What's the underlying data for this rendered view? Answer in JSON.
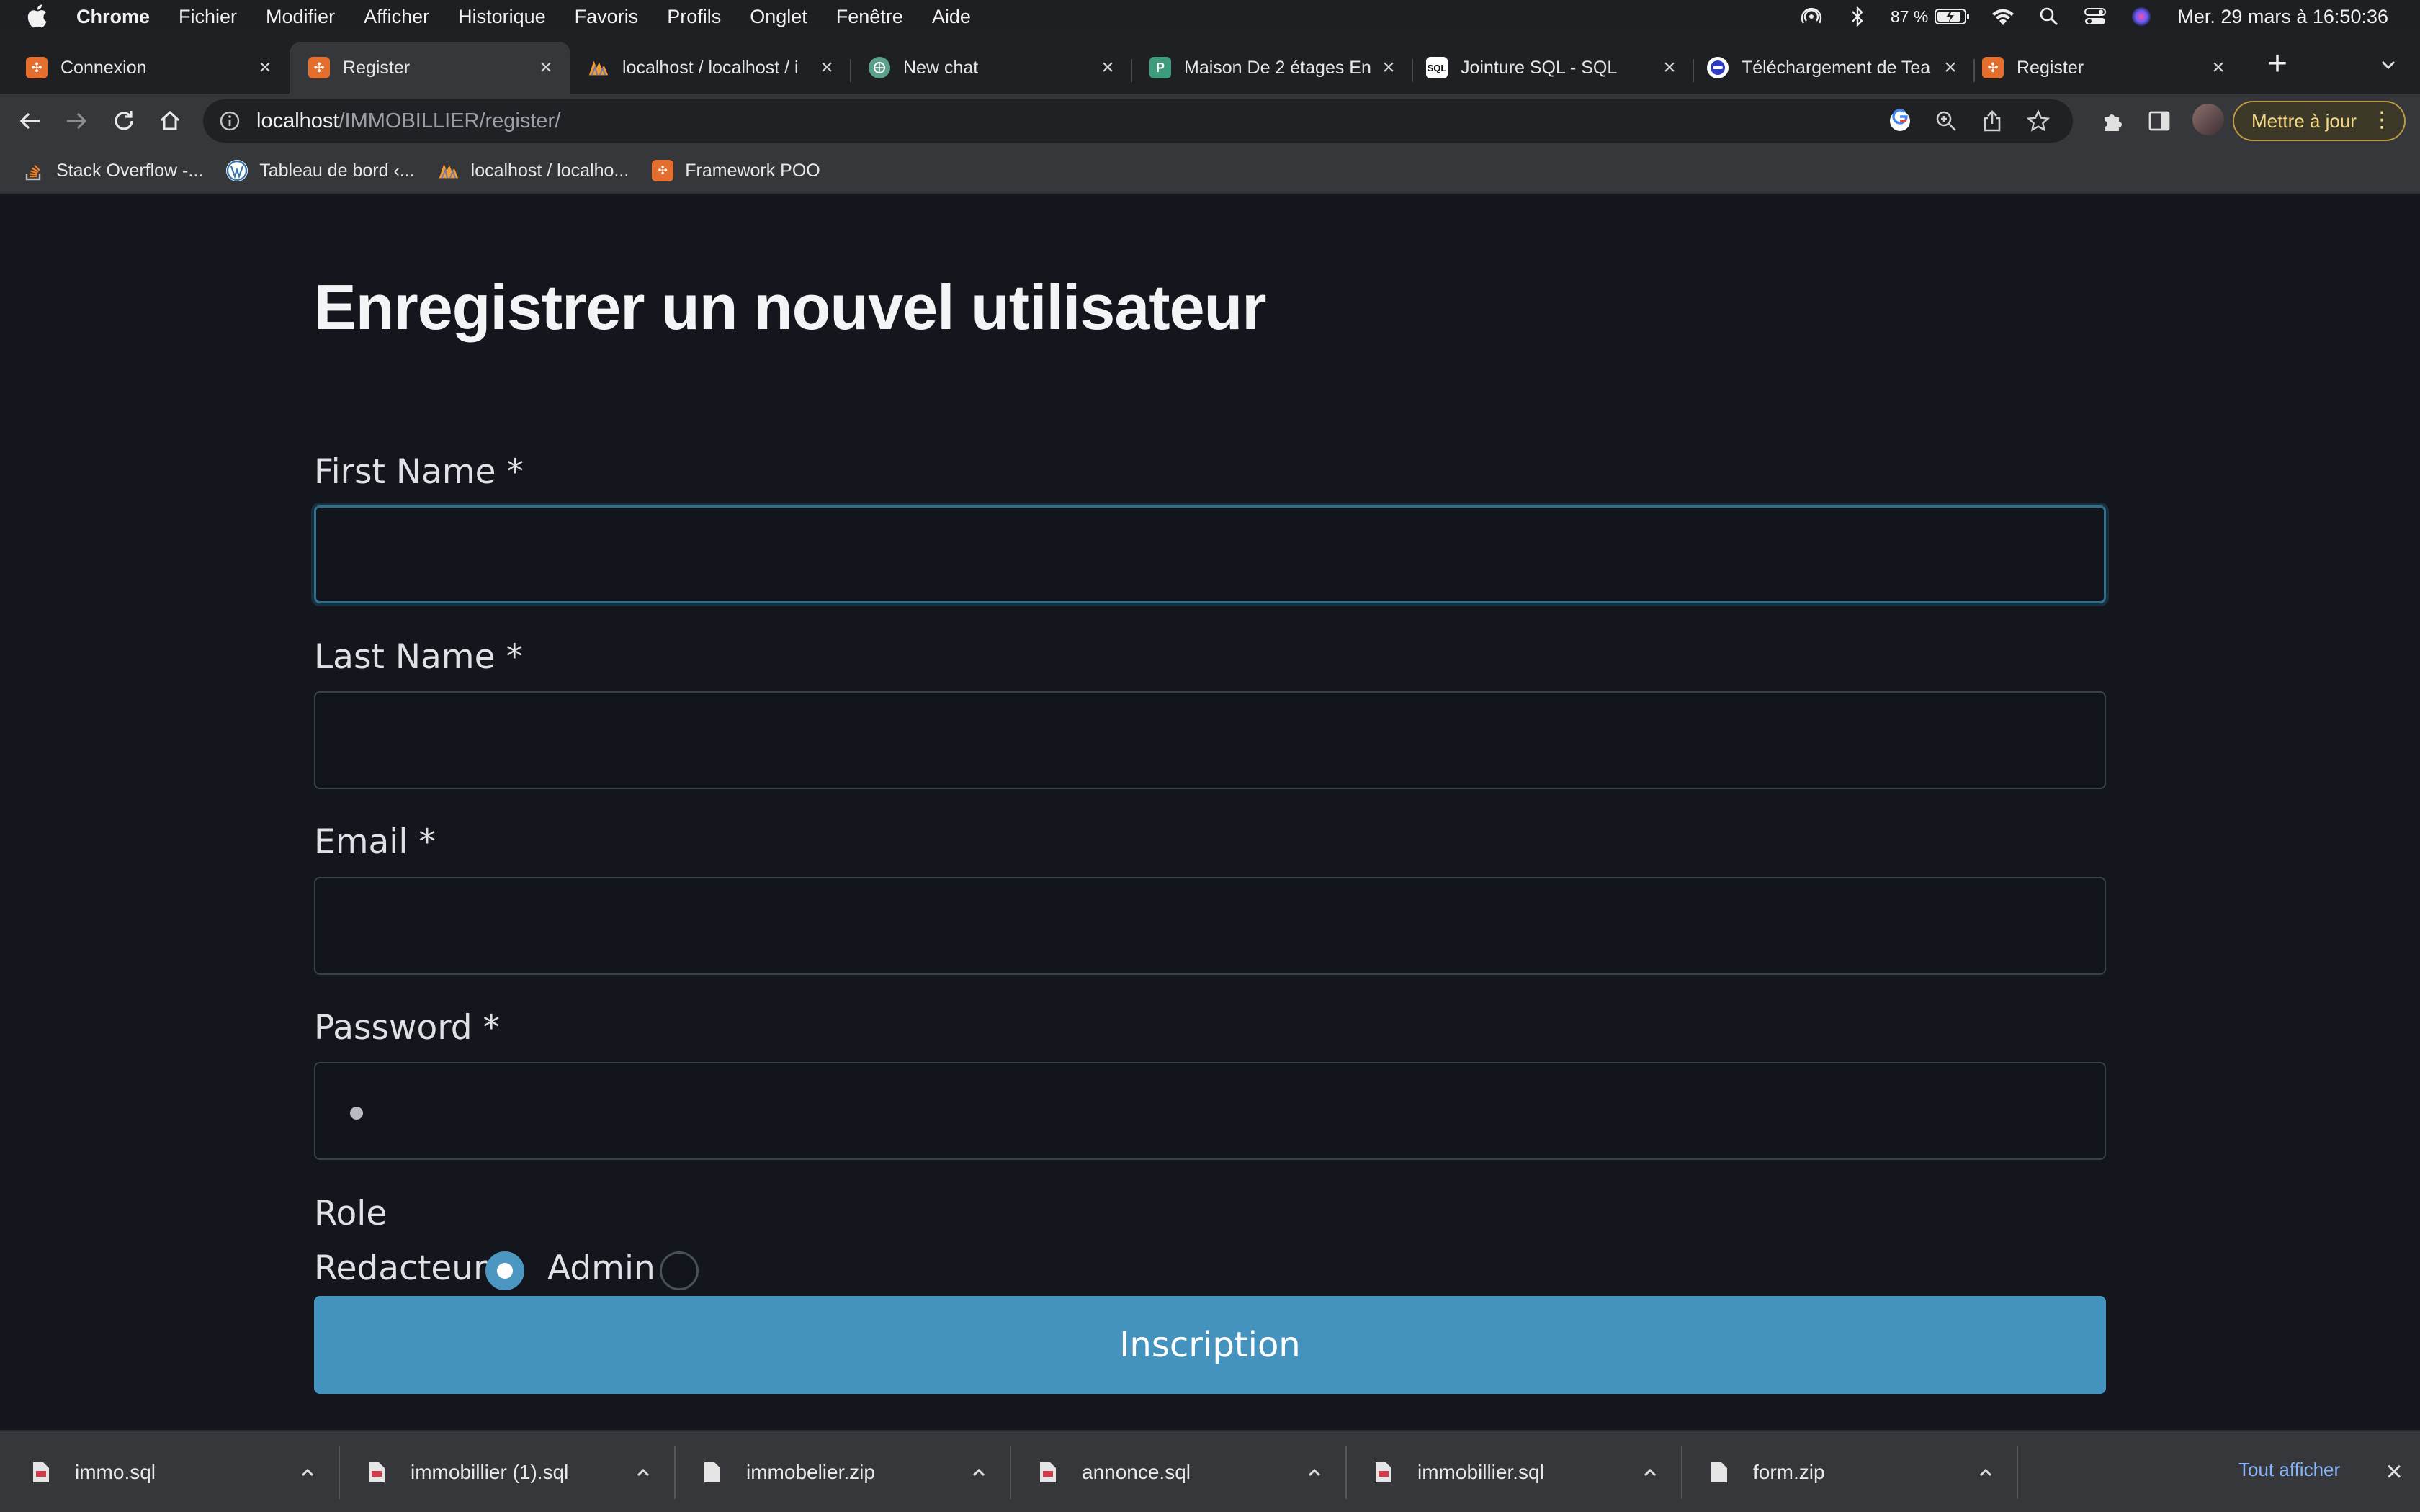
{
  "menubar": {
    "app_name": "Chrome",
    "menus": [
      "Fichier",
      "Modifier",
      "Afficher",
      "Historique",
      "Favoris",
      "Profils",
      "Onglet",
      "Fenêtre",
      "Aide"
    ],
    "battery_percent": "87 %",
    "datetime": "Mer. 29 mars à 16:50:36"
  },
  "tabs": [
    {
      "title": "Connexion",
      "favicon": "xampp-icon",
      "active": false
    },
    {
      "title": "Register",
      "favicon": "xampp-icon",
      "active": true
    },
    {
      "title": "localhost / localhost / i",
      "favicon": "phpmyadmin-icon",
      "active": false
    },
    {
      "title": "New chat",
      "favicon": "chatgpt-icon",
      "active": false
    },
    {
      "title": "Maison De 2 étages En",
      "favicon": "planner-icon",
      "active": false
    },
    {
      "title": "Jointure SQL - SQL",
      "favicon": "sql-icon",
      "active": false
    },
    {
      "title": "Téléchargement de Tea",
      "favicon": "teams-icon",
      "active": false
    },
    {
      "title": "Register",
      "favicon": "xampp-icon",
      "active": false
    }
  ],
  "address_bar": {
    "host": "localhost",
    "path": "/IMMOBILLIER/register/"
  },
  "update_button": "Mettre à jour",
  "bookmarks": [
    {
      "label": "Stack Overflow -...",
      "icon": "stackoverflow-icon"
    },
    {
      "label": "Tableau de bord ‹...",
      "icon": "wordpress-icon"
    },
    {
      "label": "localhost / localho...",
      "icon": "phpmyadmin-icon"
    },
    {
      "label": "Framework POO",
      "icon": "xampp-icon"
    }
  ],
  "form": {
    "title": "Enregistrer un nouvel utilisateur",
    "first_name_label": "First Name *",
    "last_name_label": "Last Name *",
    "email_label": "Email *",
    "password_label": "Password *",
    "role_label": "Role",
    "role_options": [
      {
        "label": "Redacteur",
        "checked": true
      },
      {
        "label": "Admin",
        "checked": false
      }
    ],
    "submit_label": "Inscription"
  },
  "downloads": {
    "files": [
      "immo.sql",
      "immobillier (1).sql",
      "immobelier.zip",
      "annonce.sql",
      "immobillier.sql",
      "form.zip"
    ],
    "show_all_label": "Tout afficher"
  },
  "colors": {
    "page_background": "#13171d",
    "accent": "#4493bf",
    "focus_border": "#2d6f8c",
    "update_text": "#f6d982"
  }
}
